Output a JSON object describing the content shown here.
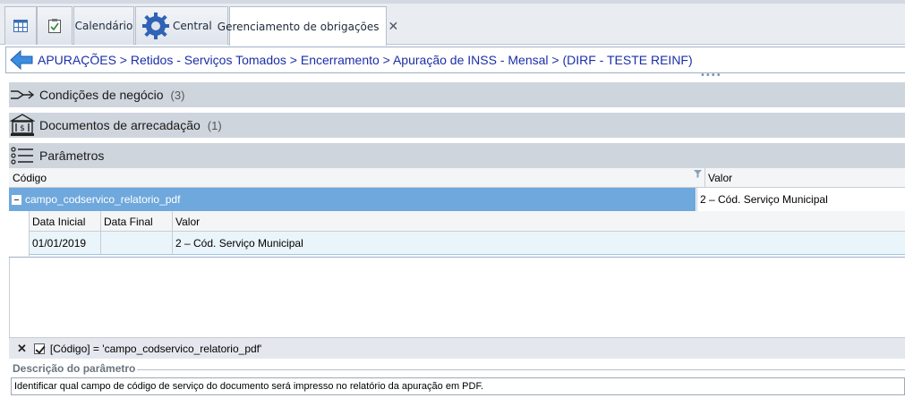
{
  "tabs": [
    {
      "label": "",
      "icon": "grid-icon"
    },
    {
      "label": "",
      "icon": "clipboard-icon"
    },
    {
      "label": "Calendário"
    },
    {
      "label": "Central",
      "icon": "gear-icon"
    },
    {
      "label": "Gerenciamento de obrigações",
      "active": true,
      "close": "✕"
    }
  ],
  "breadcrumb": "APURAÇÕES > Retidos - Serviços Tomados > Encerramento > Apuração de INSS - Mensal > (DIRF - TESTE REINF)",
  "sections": {
    "condicoes": {
      "title": "Condições de negócio",
      "count": "(3)"
    },
    "documentos": {
      "title": "Documentos de arrecadação",
      "count": "(1)"
    },
    "parametros": {
      "title": "Parâmetros"
    }
  },
  "grid": {
    "headers": {
      "codigo": "Código",
      "valor": "Valor"
    },
    "row": {
      "codigo": "campo_codservico_relatorio_pdf",
      "valor": "2 – Cód. Serviço Municipal"
    },
    "detail": {
      "headers": [
        "Data Inicial",
        "Data Final",
        "Valor"
      ],
      "row": [
        "01/01/2019",
        "",
        "2 – Cód. Serviço Municipal"
      ]
    }
  },
  "filter": {
    "close": "✕",
    "text": "[Código] = 'campo_codservico_relatorio_pdf'"
  },
  "description": {
    "label": "Descrição do parâmetro",
    "text": "Identificar qual campo de código de serviço do documento será impresso no relatório da apuração em PDF."
  }
}
